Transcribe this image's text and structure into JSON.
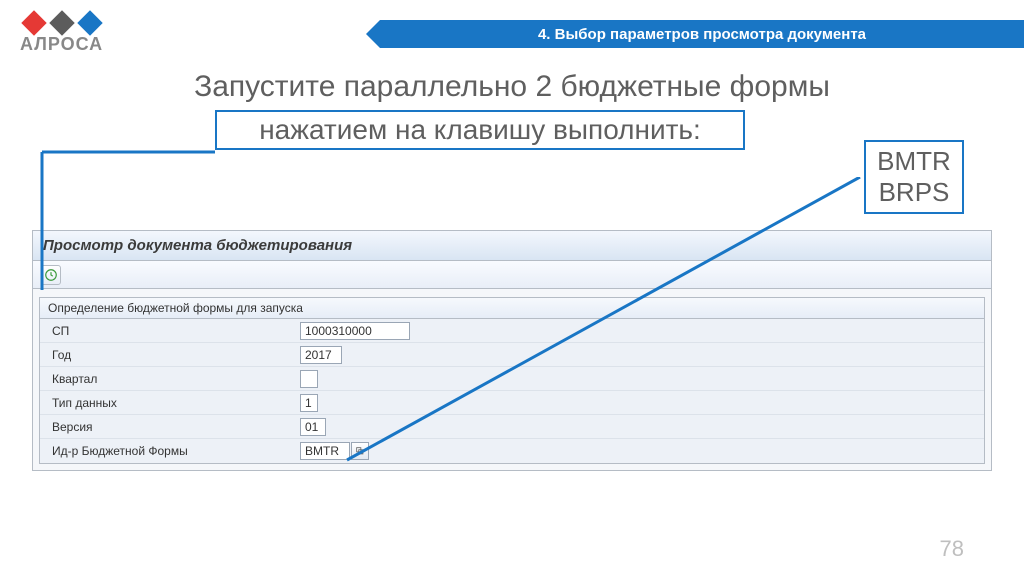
{
  "banner": {
    "text": "4. Выбор параметров просмотра документа"
  },
  "logo": {
    "text": "АЛРОСА"
  },
  "instruction": {
    "line1": "Запустите параллельно 2 бюджетные формы",
    "line2": "нажатием на клавишу выполнить:"
  },
  "callout": {
    "code1": "BMTR",
    "code2": "BRPS"
  },
  "sap": {
    "window_title": "Просмотр документа бюджетирования",
    "group_title": "Определение бюджетной формы для запуска",
    "fields": {
      "sp": {
        "label": "СП",
        "value": "1000310000"
      },
      "year": {
        "label": "Год",
        "value": "2017"
      },
      "quarter": {
        "label": "Квартал",
        "value": ""
      },
      "type": {
        "label": "Тип данных",
        "value": "1"
      },
      "version": {
        "label": "Версия",
        "value": "01"
      },
      "form_id": {
        "label": "Ид-р Бюджетной Формы",
        "value": "BMTR"
      }
    }
  },
  "page": "78"
}
